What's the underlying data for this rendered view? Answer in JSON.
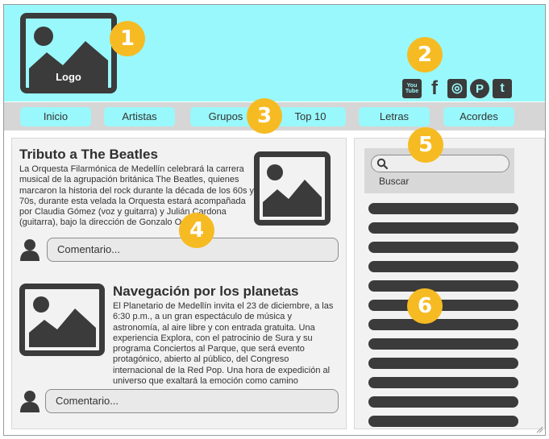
{
  "header": {
    "logo_label": "Logo",
    "social_icons": [
      {
        "name": "youtube-icon",
        "label": "You Tube"
      },
      {
        "name": "facebook-icon",
        "label": "f"
      },
      {
        "name": "instagram-icon",
        "label": "◎"
      },
      {
        "name": "pinterest-icon",
        "label": "P"
      },
      {
        "name": "twitter-icon",
        "label": "t"
      }
    ]
  },
  "nav": {
    "items": [
      {
        "label": "Inicio"
      },
      {
        "label": "Artistas"
      },
      {
        "label": "Grupos"
      },
      {
        "label": "Top 10"
      },
      {
        "label": "Letras"
      },
      {
        "label": "Acordes"
      }
    ]
  },
  "articles": [
    {
      "title": "Tributo a The Beatles",
      "body": "La Orquesta Filarmónica de Medellín celebrará la carrera musical de la agrupación británica The Beatles, quienes marcaron la historia del rock durante la década de los 60s y 70s, durante esta velada la Orquesta estará acompañada por Claudia Gómez (voz y guitarra) y Julián Cardona (guitarra), bajo la dirección de Gonzalo Ospina.",
      "comment_placeholder": "Comentario..."
    },
    {
      "title": "Navegación por los planetas",
      "body": "El Planetario de Medellín invita el 23 de diciembre, a las 6:30 p.m., a un gran espectáculo de música y astronomía, al aire libre y con entrada gratuita. Una experiencia Explora, con el patrocinio de Sura y su programa Conciertos al Parque, que será evento protagónico, abierto al público, del Congreso internacional de la Red Pop. Una hora de expedición al universo que exaltará la emoción como camino",
      "comment_placeholder": "Comentario..."
    }
  ],
  "sidebar": {
    "search_label": "Buscar",
    "list_item_count": 12
  },
  "badges": [
    "1",
    "2",
    "3",
    "4",
    "5",
    "6"
  ],
  "colors": {
    "header_bg": "#99f8fb",
    "nav_bg": "#d6d6d6",
    "badge": "#f6bb23",
    "icon_dark": "#3b3b3b",
    "panel_bg": "#f2f2f2"
  }
}
